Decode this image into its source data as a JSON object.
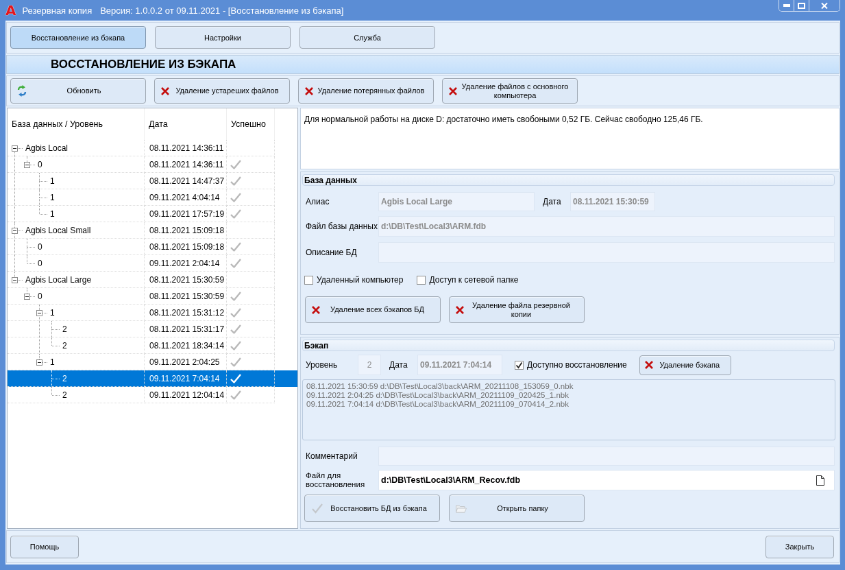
{
  "window": {
    "logo_letter": "A",
    "title": "Резервная копия",
    "subtitle": "Версия: 1.0.0.2 от 09.11.2021 - [Восстановление из бэкапа]"
  },
  "tabs": [
    {
      "label": "Восстановление из бэкапа",
      "selected": true
    },
    {
      "label": "Настройки",
      "selected": false
    },
    {
      "label": "Служба",
      "selected": false
    }
  ],
  "section_title": "ВОССТАНОВЛЕНИЕ ИЗ БЭКАПА",
  "toolbar": [
    {
      "kind": "refresh",
      "label": "Обновить"
    },
    {
      "kind": "delete",
      "label": "Удаление устареших файлов"
    },
    {
      "kind": "delete",
      "label": "Удаление потерянных файлов"
    },
    {
      "kind": "delete",
      "label": "Удаление файлов с основного компьютера"
    }
  ],
  "tree": {
    "columns": [
      "База данных / Уровень",
      "Дата",
      "Успешно"
    ],
    "nodes": [
      {
        "label": "Agbis Local",
        "date": "08.11.2021 14:36:11",
        "success": false,
        "expanded": true,
        "selected": false,
        "children": [
          {
            "label": "0",
            "date": "08.11.2021 14:36:11",
            "success": true,
            "expanded": true,
            "selected": false,
            "children": [
              {
                "label": "1",
                "date": "08.11.2021 14:47:37",
                "success": true,
                "selected": false
              },
              {
                "label": "1",
                "date": "09.11.2021 4:04:14",
                "success": true,
                "selected": false
              },
              {
                "label": "1",
                "date": "09.11.2021 17:57:19",
                "success": true,
                "selected": false
              }
            ]
          }
        ]
      },
      {
        "label": "Agbis Local Small",
        "date": "08.11.2021 15:09:18",
        "success": false,
        "expanded": true,
        "selected": false,
        "children": [
          {
            "label": "0",
            "date": "08.11.2021 15:09:18",
            "success": true,
            "selected": false
          },
          {
            "label": "0",
            "date": "09.11.2021 2:04:14",
            "success": true,
            "selected": false
          }
        ]
      },
      {
        "label": "Agbis Local Large",
        "date": "08.11.2021 15:30:59",
        "success": false,
        "expanded": true,
        "selected": false,
        "children": [
          {
            "label": "0",
            "date": "08.11.2021 15:30:59",
            "success": true,
            "expanded": true,
            "selected": false,
            "children": [
              {
                "label": "1",
                "date": "08.11.2021 15:31:12",
                "success": true,
                "expanded": true,
                "selected": false,
                "children": [
                  {
                    "label": "2",
                    "date": "08.11.2021 15:31:17",
                    "success": true,
                    "selected": false
                  },
                  {
                    "label": "2",
                    "date": "08.11.2021 18:34:14",
                    "success": true,
                    "selected": false
                  }
                ]
              },
              {
                "label": "1",
                "date": "09.11.2021 2:04:25",
                "success": true,
                "expanded": true,
                "selected": false,
                "children": [
                  {
                    "label": "2",
                    "date": "09.11.2021 7:04:14",
                    "success": true,
                    "selected": true
                  },
                  {
                    "label": "2",
                    "date": "09.11.2021 12:04:14",
                    "success": true,
                    "selected": false
                  }
                ]
              }
            ]
          }
        ]
      }
    ]
  },
  "disk_info": "Для нормальной работы на диске D: достаточно иметь свобоными 0,52 ГБ. Сейчас свободно 125,46 ГБ.",
  "database": {
    "title": "База данных",
    "alias": {
      "label": "Алиас",
      "value": "Agbis Local Large"
    },
    "date": {
      "label": "Дата",
      "value": "08.11.2021 15:30:59"
    },
    "file": {
      "label": "Файл базы данных",
      "value": "d:\\DB\\Test\\Local3\\ARM.fdb"
    },
    "description": {
      "label": "Описание БД"
    },
    "checkboxes": [
      {
        "label": "Удаленный компьютер",
        "checked": false
      },
      {
        "label": "Доступ к сетевой папке",
        "checked": false
      }
    ],
    "buttons": [
      "Удаление всех бэкапов БД",
      "Удаление файла резервной копии"
    ]
  },
  "backup": {
    "title": "Бэкап",
    "level": {
      "label": "Уровень",
      "value": "2"
    },
    "date": {
      "label": "Дата",
      "value": "09.11.2021 7:04:14"
    },
    "restore_available": {
      "label": "Доступно восстановление",
      "checked": true
    },
    "delete_button": "Удаление бэкапа",
    "log": [
      "08.11.2021 15:30:59 d:\\DB\\Test\\Local3\\back\\ARM_20211108_153059_0.nbk",
      "09.11.2021 2:04:25 d:\\DB\\Test\\Local3\\back\\ARM_20211109_020425_1.nbk",
      "09.11.2021 7:04:14 d:\\DB\\Test\\Local3\\back\\ARM_20211109_070414_2.nbk"
    ],
    "comment": {
      "label": "Комментарий"
    },
    "restore_file": {
      "label": "Файл для восстановления",
      "value": "d:\\DB\\Test\\Local3\\ARM_Recov.fdb"
    },
    "buttons": [
      {
        "kind": "restore",
        "label": "Восстановить БД из бэкапа"
      },
      {
        "kind": "open_folder",
        "label": "Открыть папку"
      }
    ]
  },
  "footer": {
    "help_button": "Помощь",
    "close_button": "Закрыть"
  }
}
